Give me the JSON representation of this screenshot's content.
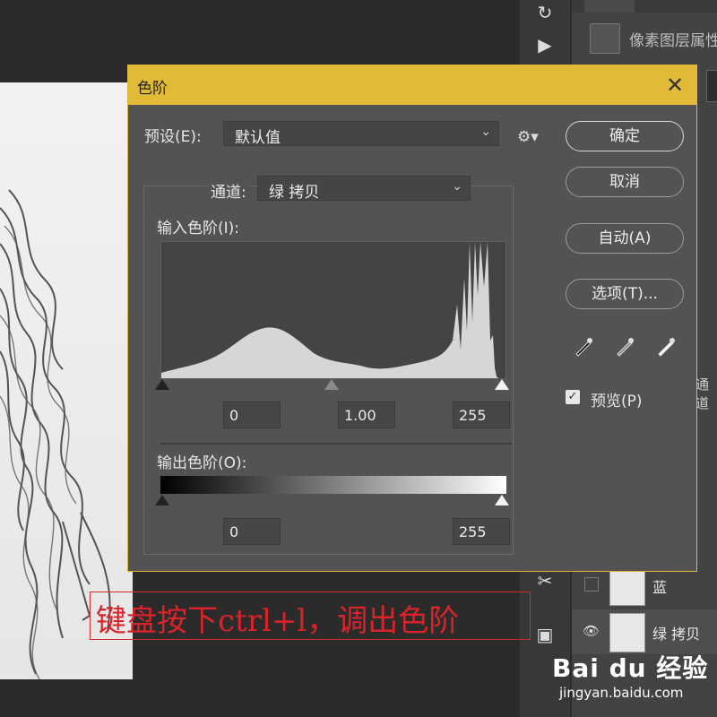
{
  "dialog": {
    "title": "色阶",
    "preset_label": "预设(E):",
    "preset_value": "默认值",
    "channel_label": "通道:",
    "channel_value": "绿 拷贝",
    "input_levels_label": "输入色阶(I):",
    "input_black": "0",
    "input_gamma": "1.00",
    "input_white": "255",
    "output_levels_label": "输出色阶(O):",
    "output_black": "0",
    "output_white": "255",
    "buttons": {
      "ok": "确定",
      "cancel": "取消",
      "auto": "自动(A)",
      "options": "选项(T)..."
    },
    "preview_label": "预览(P)",
    "preview_checked": true
  },
  "right_panel": {
    "properties_title": "像素图层属性",
    "channel_fragment": "通道",
    "layers": [
      {
        "name": "蓝",
        "visible": false
      },
      {
        "name": "绿 拷贝",
        "visible": true
      }
    ]
  },
  "caption": {
    "text": "键盘按下ctrl+l，调出色阶"
  },
  "watermark": {
    "logo": "Bai du 经验",
    "url": "jingyan.baidu.com"
  },
  "colors": {
    "titlebar": "#e1ba37",
    "dialog_bg": "#535353",
    "caption_red": "#d8232a"
  }
}
